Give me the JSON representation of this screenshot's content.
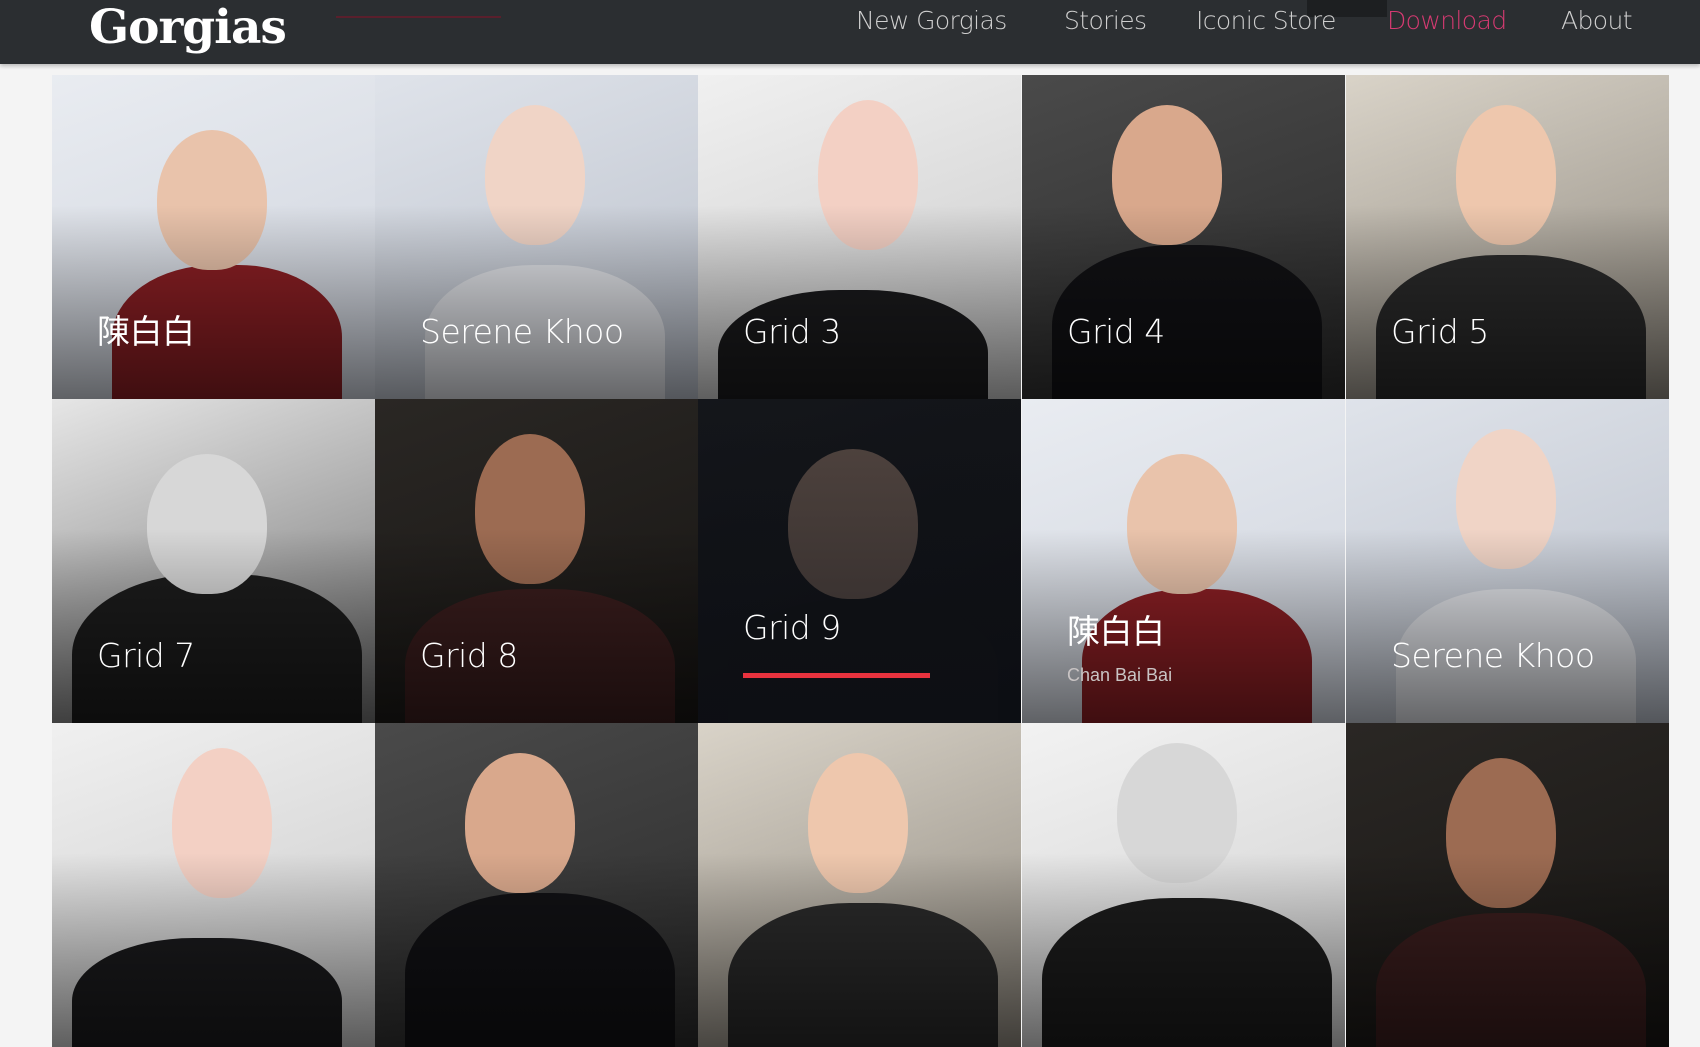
{
  "nav": {
    "brand": "Gorgias",
    "links": [
      {
        "label": "New Gorgias",
        "active": false
      },
      {
        "label": "Stories",
        "active": false
      },
      {
        "label": "Iconic Store",
        "active": false
      },
      {
        "label": "Download",
        "active": true
      },
      {
        "label": "About",
        "active": false
      }
    ]
  },
  "grid": {
    "tiles": [
      {
        "label": "陳白白",
        "subtitle": "",
        "hovered": false
      },
      {
        "label": "Serene Khoo",
        "subtitle": "",
        "hovered": false
      },
      {
        "label": "Grid 3",
        "subtitle": "",
        "hovered": false
      },
      {
        "label": "Grid 4",
        "subtitle": "",
        "hovered": false
      },
      {
        "label": "Grid 5",
        "subtitle": "",
        "hovered": false
      },
      {
        "label": "Grid 7",
        "subtitle": "",
        "hovered": false
      },
      {
        "label": "Grid 8",
        "subtitle": "",
        "hovered": false
      },
      {
        "label": "Grid 9",
        "subtitle": "",
        "hovered": true
      },
      {
        "label": "陳白白",
        "subtitle": "Chan Bai Bai",
        "hovered": false
      },
      {
        "label": "Serene Khoo",
        "subtitle": "",
        "hovered": false
      },
      {
        "label": "",
        "subtitle": "",
        "hovered": false
      },
      {
        "label": "",
        "subtitle": "",
        "hovered": false
      },
      {
        "label": "",
        "subtitle": "",
        "hovered": false
      },
      {
        "label": "",
        "subtitle": "",
        "hovered": false
      },
      {
        "label": "",
        "subtitle": "",
        "hovered": false
      }
    ]
  },
  "colors": {
    "navbar_bg": "#2b2e31",
    "nav_link": "#cfcfcf",
    "nav_active": "#d63a72",
    "accent_bar": "#e8323e",
    "page_bg": "#f4f4f4"
  }
}
